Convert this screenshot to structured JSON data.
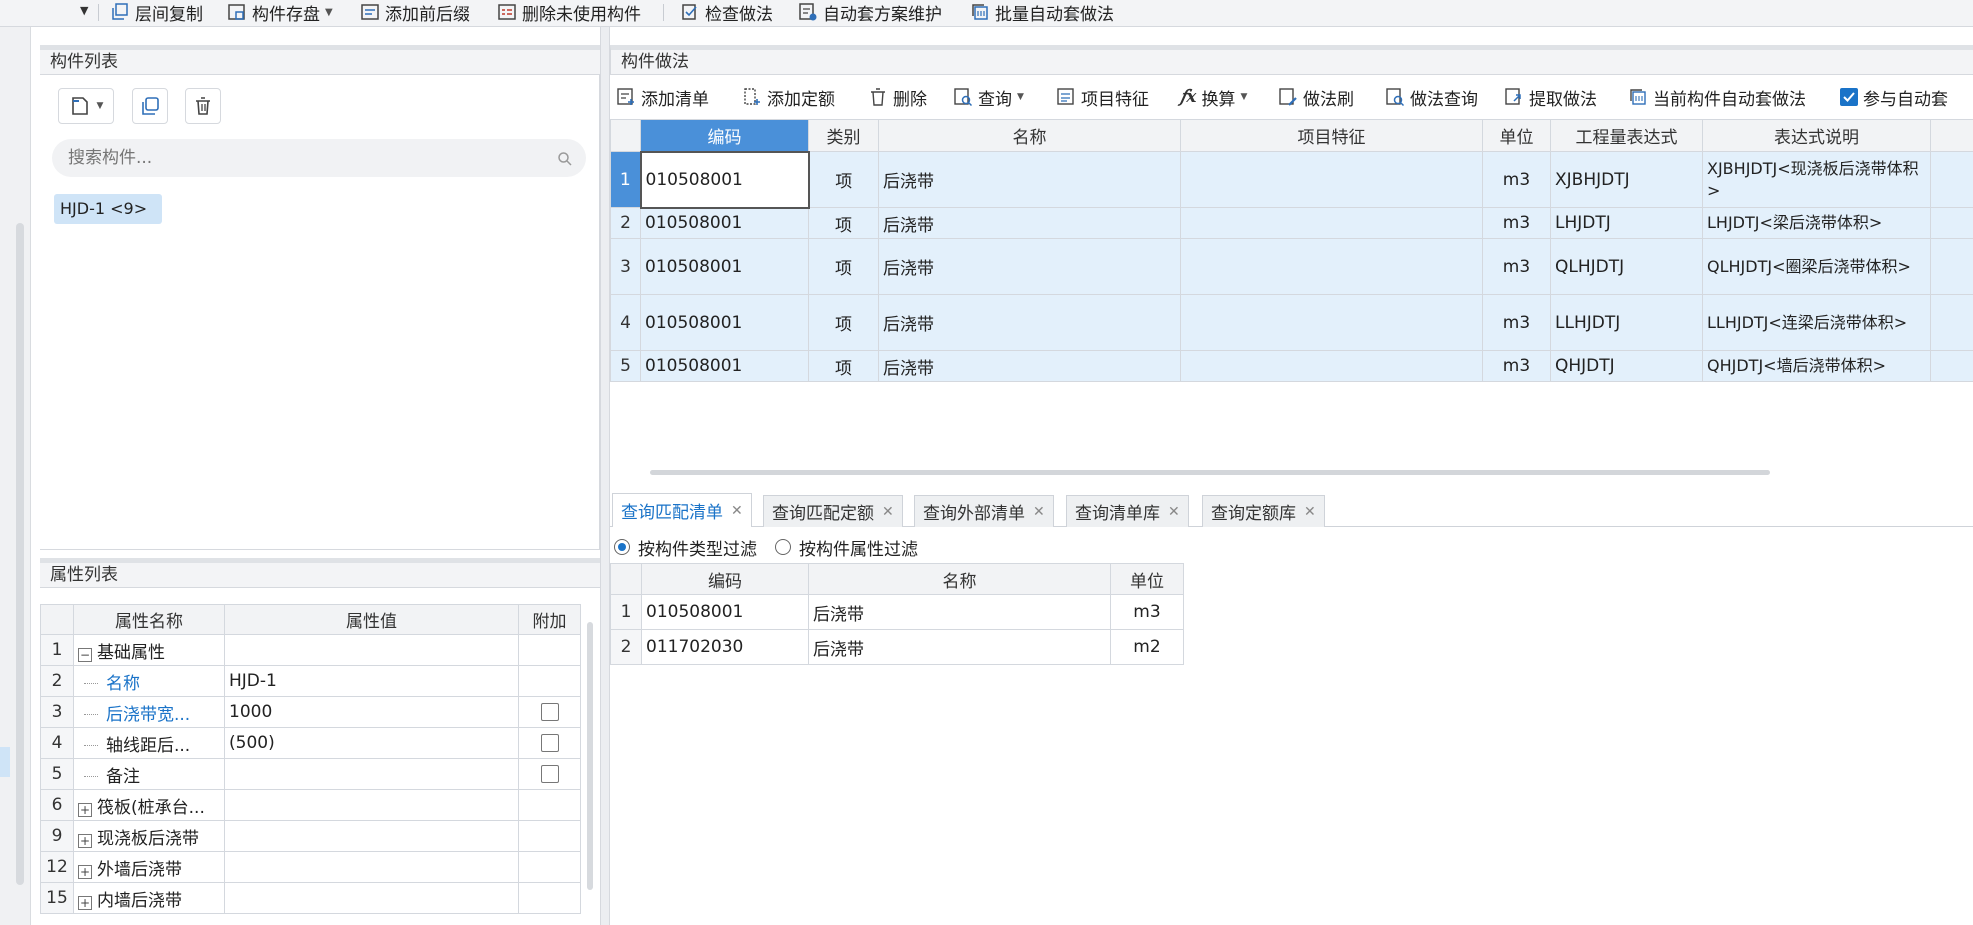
{
  "toolbar": {
    "items": [
      {
        "label": "层间复制"
      },
      {
        "label": "构件存盘"
      },
      {
        "label": "添加前后缀"
      },
      {
        "label": "删除未使用构件"
      },
      {
        "label": "检查做法"
      },
      {
        "label": "自动套方案维护"
      },
      {
        "label": "批量自动套做法"
      }
    ]
  },
  "component_list": {
    "title": "构件列表",
    "search_placeholder": "搜索构件...",
    "items": [
      {
        "label": "HJD-1 <9>"
      }
    ]
  },
  "properties": {
    "title": "属性列表",
    "headers": [
      "属性名称",
      "属性值",
      "附加"
    ],
    "rows": [
      {
        "num": "1",
        "name": "基础属性",
        "value": "",
        "group": true,
        "expanded": true
      },
      {
        "num": "2",
        "name": "名称",
        "value": "HJD-1",
        "link": true
      },
      {
        "num": "3",
        "name": "后浇带宽...",
        "value": "1000",
        "link": true,
        "check": true
      },
      {
        "num": "4",
        "name": "轴线距后...",
        "value": "(500)",
        "check": true
      },
      {
        "num": "5",
        "name": "备注",
        "value": "",
        "check": true
      },
      {
        "num": "6",
        "name": "筏板(桩承台...",
        "value": "",
        "group": true
      },
      {
        "num": "9",
        "name": "现浇板后浇带",
        "value": "",
        "group": true
      },
      {
        "num": "12",
        "name": "外墙后浇带",
        "value": "",
        "group": true
      },
      {
        "num": "15",
        "name": "内墙后浇带",
        "value": "",
        "group": true
      }
    ]
  },
  "method": {
    "title": "构件做法",
    "toolbar": [
      {
        "label": "添加清单"
      },
      {
        "label": "添加定额"
      },
      {
        "label": "删除"
      },
      {
        "label": "查询"
      },
      {
        "label": "项目特征"
      },
      {
        "label": "换算"
      },
      {
        "label": "做法刷"
      },
      {
        "label": "做法查询"
      },
      {
        "label": "提取做法"
      },
      {
        "label": "当前构件自动套做法"
      },
      {
        "label": "参与自动套"
      }
    ],
    "headers": [
      "编码",
      "类别",
      "名称",
      "项目特征",
      "单位",
      "工程量表达式",
      "表达式说明"
    ],
    "rows": [
      {
        "num": "1",
        "code": "010508001",
        "type": "项",
        "name": "后浇带",
        "feature": "",
        "unit": "m3",
        "expr": "XJBHJDTJ",
        "desc": "XJBHJDTJ<现浇板后浇带体积>"
      },
      {
        "num": "2",
        "code": "010508001",
        "type": "项",
        "name": "后浇带",
        "feature": "",
        "unit": "m3",
        "expr": "LHJDTJ",
        "desc": "LHJDTJ<梁后浇带体积>"
      },
      {
        "num": "3",
        "code": "010508001",
        "type": "项",
        "name": "后浇带",
        "feature": "",
        "unit": "m3",
        "expr": "QLHJDTJ",
        "desc": "QLHJDTJ<圈梁后浇带体积>"
      },
      {
        "num": "4",
        "code": "010508001",
        "type": "项",
        "name": "后浇带",
        "feature": "",
        "unit": "m3",
        "expr": "LLHJDTJ",
        "desc": "LLHJDTJ<连梁后浇带体积>"
      },
      {
        "num": "5",
        "code": "010508001",
        "type": "项",
        "name": "后浇带",
        "feature": "",
        "unit": "m3",
        "expr": "QHJDTJ",
        "desc": "QHJDTJ<墙后浇带体积>"
      }
    ]
  },
  "query": {
    "tabs": [
      {
        "label": "查询匹配清单"
      },
      {
        "label": "查询匹配定额"
      },
      {
        "label": "查询外部清单"
      },
      {
        "label": "查询清单库"
      },
      {
        "label": "查询定额库"
      }
    ],
    "filters": [
      {
        "label": "按构件类型过滤",
        "selected": true
      },
      {
        "label": "按构件属性过滤",
        "selected": false
      }
    ],
    "headers": [
      "编码",
      "名称",
      "单位"
    ],
    "rows": [
      {
        "num": "1",
        "code": "010508001",
        "name": "后浇带",
        "unit": "m3"
      },
      {
        "num": "2",
        "code": "011702030",
        "name": "后浇带",
        "unit": "m2"
      }
    ]
  },
  "colors": {
    "accent": "#1a73c8",
    "selection": "#e3f0fb",
    "header": "#4a90d9"
  }
}
